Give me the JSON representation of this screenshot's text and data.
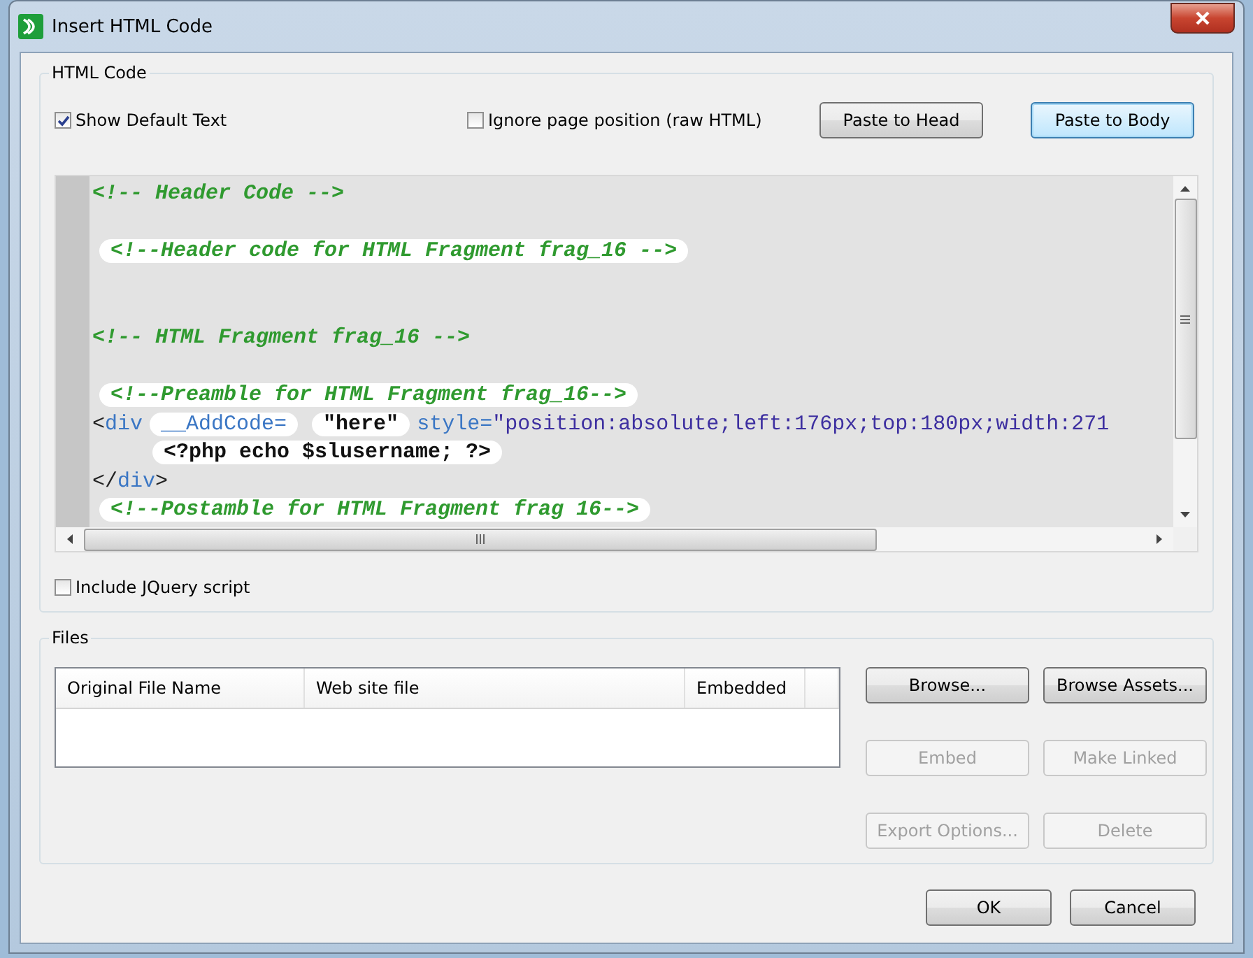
{
  "window": {
    "title": "Insert HTML Code"
  },
  "html_code": {
    "legend": "HTML Code",
    "options": [
      {
        "label": "Show Default Text",
        "checked": true
      },
      {
        "label": "Ignore page position (raw HTML)",
        "checked": false
      }
    ],
    "buttons": [
      {
        "label": "Paste to Head",
        "default": false
      },
      {
        "label": "Paste to Body",
        "default": true
      }
    ],
    "code_lines": [
      {
        "kind": "code",
        "segments": [
          {
            "text": "<!-- Header Code -->",
            "kind": "comment",
            "highlight": false
          }
        ]
      },
      {
        "kind": "blank"
      },
      {
        "kind": "code",
        "segments": [
          {
            "text": "<!--Header code for HTML Fragment frag_16 -->",
            "kind": "comment",
            "highlight": true
          }
        ]
      },
      {
        "kind": "blank"
      },
      {
        "kind": "blank"
      },
      {
        "kind": "code",
        "segments": [
          {
            "text": "<!-- HTML Fragment frag_16 -->",
            "kind": "comment",
            "highlight": false
          }
        ]
      },
      {
        "kind": "blank"
      },
      {
        "kind": "code",
        "segments": [
          {
            "text": "<!--Preamble for HTML Fragment frag_16-->",
            "kind": "comment",
            "highlight": true
          }
        ]
      },
      {
        "kind": "code",
        "segments": [
          {
            "text": "<",
            "kind": "punct",
            "highlight": false
          },
          {
            "text": "div",
            "kind": "tag",
            "highlight": false
          },
          {
            "text": "__AddCode=",
            "kind": "attr",
            "highlight": true
          },
          {
            "text": "\"here\"",
            "kind": "text",
            "highlight": true
          },
          {
            "text": "style=",
            "kind": "attr",
            "highlight": false
          },
          {
            "text": "\"position:absolute;left:176px;top:180px;width:271",
            "kind": "value",
            "highlight": false
          }
        ]
      },
      {
        "kind": "indented",
        "segments": [
          {
            "text": "<?php echo $slusername; ?>",
            "kind": "text",
            "highlight": true
          }
        ]
      },
      {
        "kind": "code",
        "segments": [
          {
            "text": "</",
            "kind": "punct",
            "highlight": false
          },
          {
            "text": "div",
            "kind": "tag",
            "highlight": false
          },
          {
            "text": ">",
            "kind": "punct",
            "highlight": false
          }
        ]
      },
      {
        "kind": "code",
        "segments": [
          {
            "text": "<!--Postamble for HTML Fragment frag 16-->",
            "kind": "comment",
            "highlight": true
          }
        ]
      }
    ],
    "jquery": {
      "label": "Include JQuery script",
      "checked": false
    }
  },
  "files": {
    "legend": "Files",
    "columns": [
      "Original File Name",
      "Web site file",
      "Embedded"
    ],
    "buttons": [
      {
        "label": "Browse...",
        "disabled": false
      },
      {
        "label": "Browse Assets...",
        "disabled": false
      },
      {
        "label": "Embed",
        "disabled": true
      },
      {
        "label": "Make Linked",
        "disabled": true
      },
      {
        "label": "Export Options...",
        "disabled": true
      },
      {
        "label": "Delete",
        "disabled": true
      }
    ]
  },
  "footer_buttons": [
    {
      "label": "OK"
    },
    {
      "label": "Cancel"
    }
  ]
}
